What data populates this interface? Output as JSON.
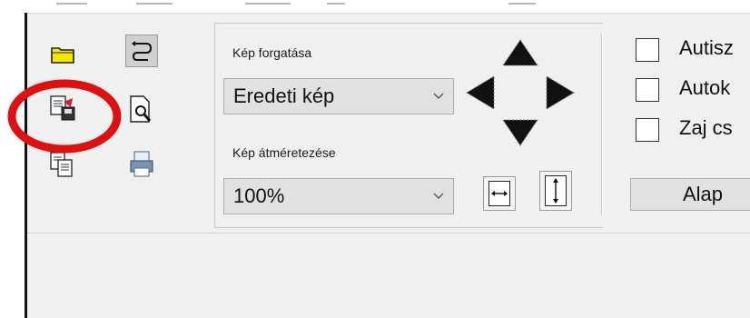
{
  "rotation": {
    "label": "Kép forgatása",
    "selected": "Eredeti kép"
  },
  "resize": {
    "label": "Kép átméretezése",
    "selected": "100%"
  },
  "checkboxes": [
    {
      "label": "Autisz"
    },
    {
      "label": "Autok"
    },
    {
      "label": "Zaj cs"
    }
  ],
  "apply_button": {
    "label": "Alap"
  },
  "highlight_color": "#e01010",
  "icons": [
    "open-folder-icon",
    "undo-icon",
    "save-image-icon",
    "print-preview-icon",
    "copy-icon",
    "print-icon",
    "rotate-arrows-icon",
    "fit-width-icon",
    "fit-height-icon"
  ]
}
